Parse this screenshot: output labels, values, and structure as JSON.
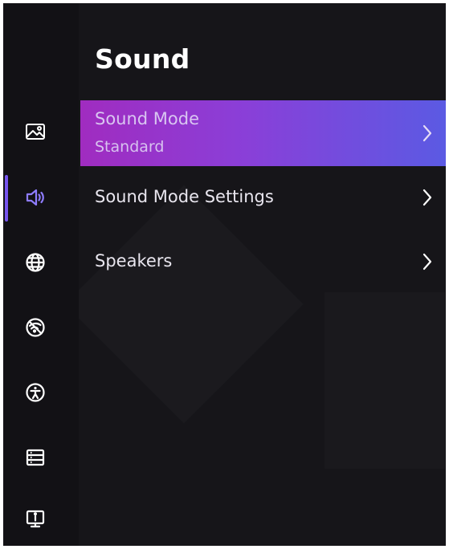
{
  "page": {
    "title": "Sound"
  },
  "sidebar": {
    "items": [
      {
        "icon": "picture-icon"
      },
      {
        "icon": "speaker-icon",
        "active": true
      },
      {
        "icon": "globe-icon"
      },
      {
        "icon": "no-signal-icon"
      },
      {
        "icon": "accessibility-icon"
      },
      {
        "icon": "list-icon"
      },
      {
        "icon": "info-monitor-icon"
      }
    ]
  },
  "menu": {
    "items": [
      {
        "label": "Sound Mode",
        "value": "Standard",
        "selected": true
      },
      {
        "label": "Sound Mode Settings"
      },
      {
        "label": "Speakers"
      }
    ]
  },
  "colors": {
    "background": "#161519",
    "rail": "#121115",
    "accent_indicator": "#7755ee",
    "selection_gradient_start": "#a02cc0",
    "selection_gradient_end": "#5b5ae3",
    "text": "#ffffff"
  }
}
